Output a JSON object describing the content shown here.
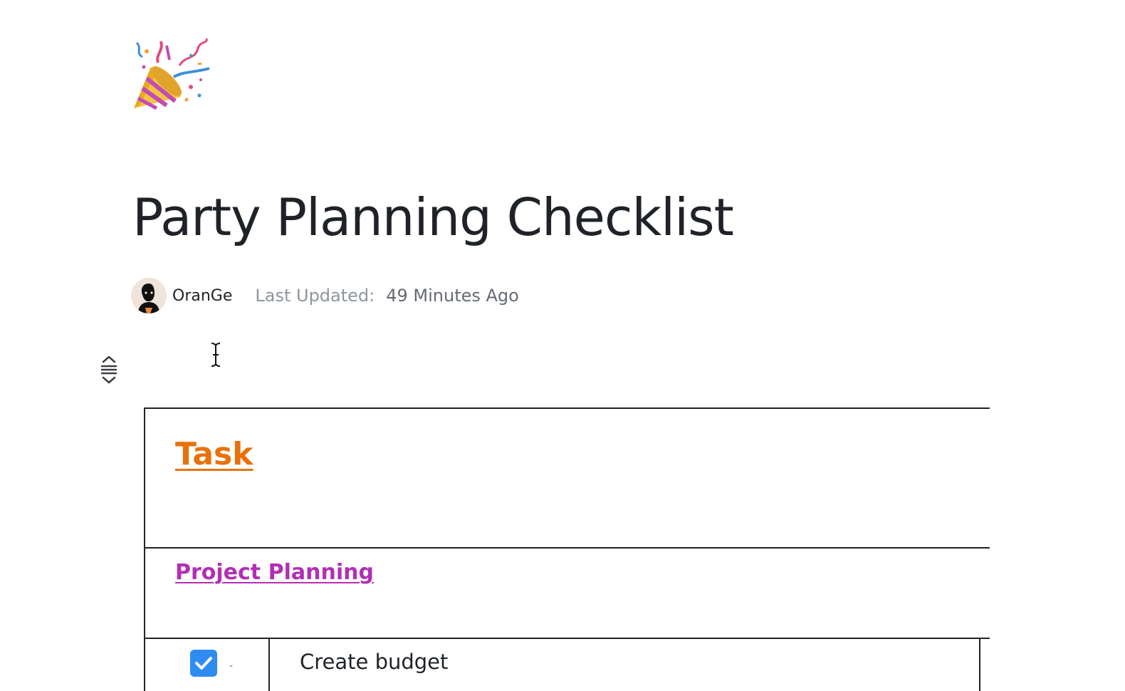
{
  "document": {
    "icon": "party-popper-icon",
    "title": "Party Planning Checklist",
    "author": {
      "name": "OranGe",
      "avatar": "user-avatar"
    },
    "last_updated_label": "Last Updated:",
    "last_updated_value": "49 Minutes Ago"
  },
  "table": {
    "header": "Task",
    "header_color": "#e8710a",
    "section": "Project Planning",
    "section_color": "#b22fb5",
    "rows": [
      {
        "checked": true,
        "handle": "-",
        "text": "Create budget"
      }
    ]
  },
  "colors": {
    "text": "#1f2329",
    "muted": "#8f959e",
    "checkbox": "#2e8cf0"
  }
}
